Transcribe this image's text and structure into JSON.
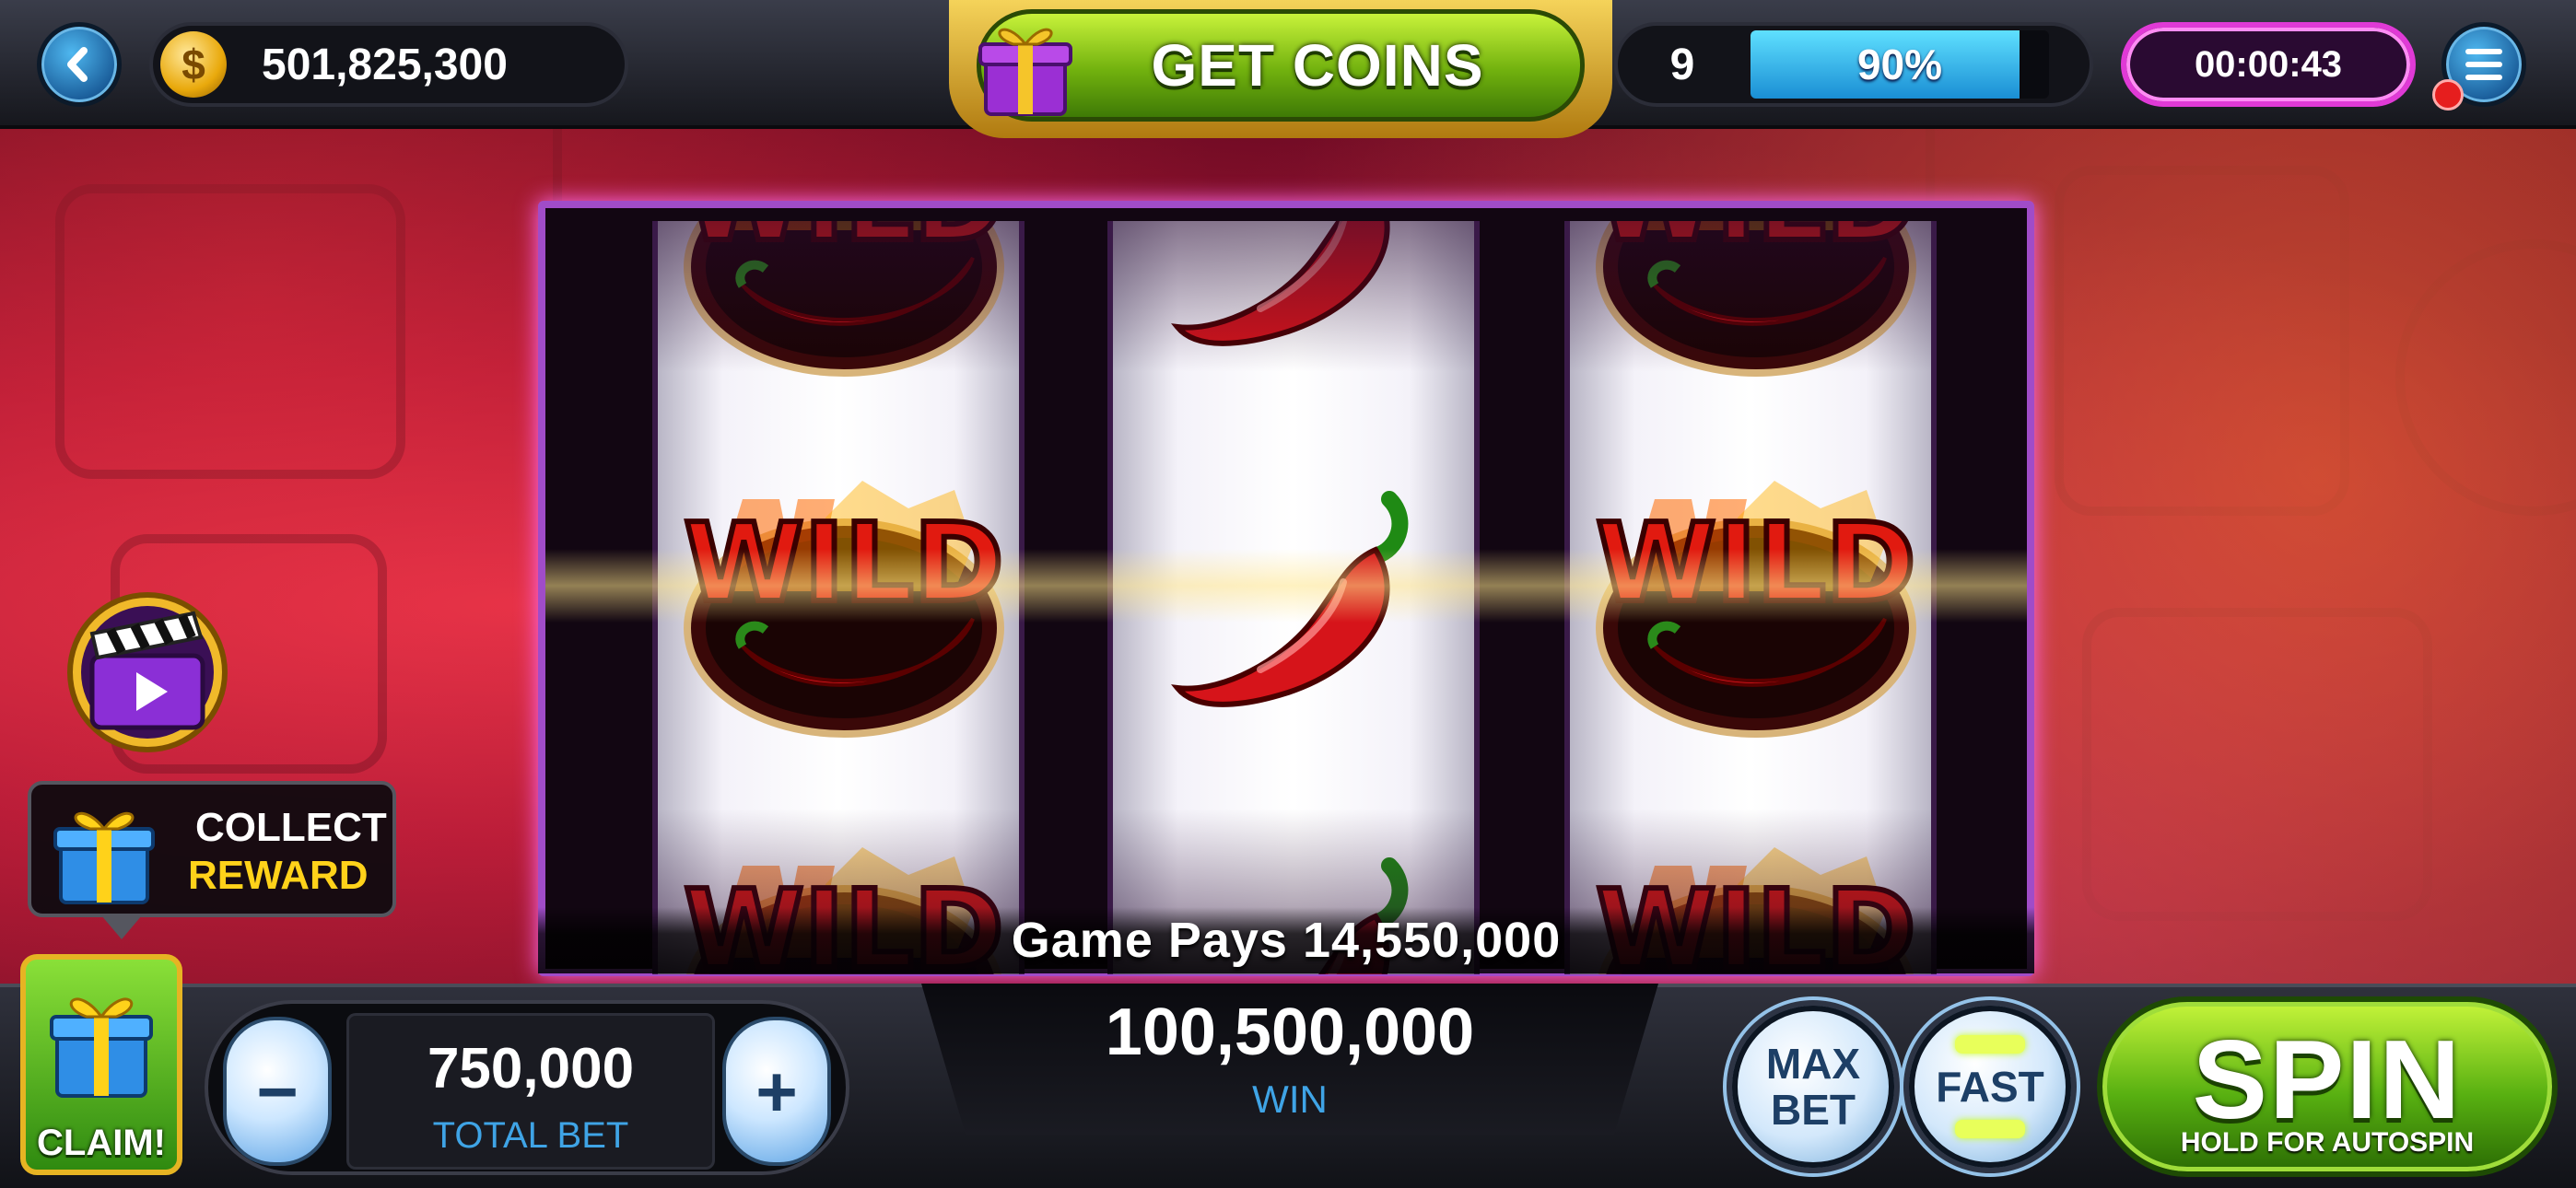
{
  "top_bar": {
    "back_icon": "chevron-left-icon",
    "coin_icon": "coin-icon",
    "coin_symbol": "$",
    "coin_balance": "501,825,300",
    "get_coins_label": "GET COINS",
    "gift_icon": "gift-icon",
    "level": "9",
    "level_progress_label": "90%",
    "level_progress": 0.9,
    "timer": "00:00:43",
    "menu_icon": "hamburger-menu-icon",
    "notification_dot_color": "#e61e1e"
  },
  "machine": {
    "reels": [
      [
        "wild-chili",
        "wild-chili",
        "wild-chili"
      ],
      [
        "chili-pepper",
        "chili-pepper",
        "chili-pepper"
      ],
      [
        "wild-chili",
        "wild-chili",
        "wild-chili"
      ]
    ],
    "wild_text": "WILD",
    "game_pays": "Game Pays 14,550,000"
  },
  "left_widgets": {
    "video_icon": "clapperboard-play-icon",
    "collect_line1": "COLLECT",
    "collect_line2": "REWARD",
    "claim_label": "CLAIM!"
  },
  "bottom_bar": {
    "minus_label": "−",
    "plus_label": "+",
    "total_bet_value": "750,000",
    "total_bet_label": "TOTAL BET",
    "win_value": "100,500,000",
    "win_label": "WIN",
    "max_bet_line1": "MAX",
    "max_bet_line2": "BET",
    "fast_label": "FAST",
    "spin_label": "SPIN",
    "spin_sub": "HOLD FOR AUTOSPIN"
  },
  "colors": {
    "accent_green": "#71b10e",
    "accent_blue": "#3fa4e6",
    "timer_magenta": "#e03ad6",
    "gold": "#ffd21a"
  }
}
